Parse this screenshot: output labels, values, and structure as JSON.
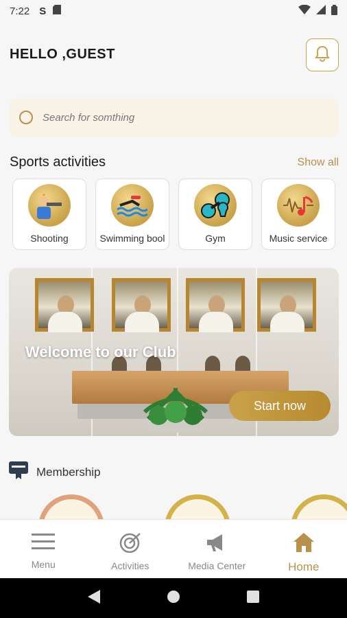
{
  "status": {
    "time": "7:22",
    "s_icon": "S"
  },
  "header": {
    "greeting": "HELLO ,GUEST"
  },
  "search": {
    "placeholder": "Search for somthing"
  },
  "sports": {
    "title": "Sports activities",
    "show_all": "Show all",
    "items": [
      {
        "label": "Shooting",
        "icon": "shooting-icon"
      },
      {
        "label": "Swimming bool",
        "icon": "swimming-icon"
      },
      {
        "label": "Gym",
        "icon": "dumbbell-icon"
      },
      {
        "label": "Music service",
        "icon": "music-icon"
      }
    ]
  },
  "banner": {
    "title": "Welcome to our Club",
    "button": "Start now"
  },
  "membership": {
    "label": "Membership"
  },
  "nav": {
    "items": [
      {
        "label": "Menu",
        "icon": "menu-icon",
        "active": false
      },
      {
        "label": "Activities",
        "icon": "target-icon",
        "active": false
      },
      {
        "label": "Media Center",
        "icon": "megaphone-icon",
        "active": false
      },
      {
        "label": "Home",
        "icon": "home-icon",
        "active": true
      }
    ]
  },
  "colors": {
    "accent": "#c9a24a",
    "background": "#f6f6f6",
    "search_bg": "#f8f3e6"
  }
}
